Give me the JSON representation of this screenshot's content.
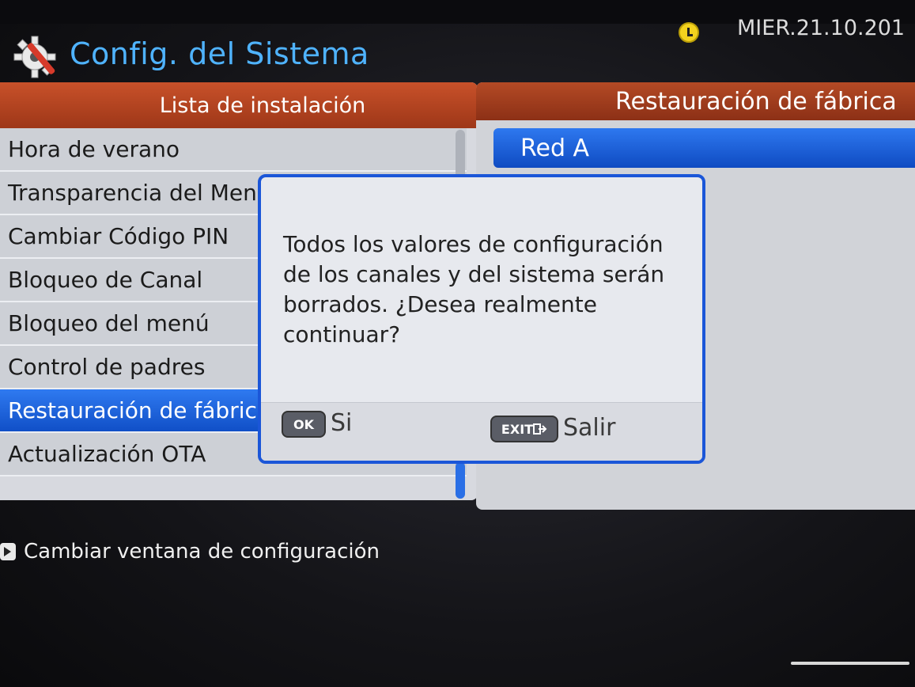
{
  "header": {
    "title": "Config. del Sistema",
    "date": "MIER.21.10.201",
    "icons": {
      "app": "settings-gear-icon",
      "clock": "clock-icon"
    }
  },
  "left_panel": {
    "title": "Lista de instalación",
    "items": [
      {
        "label": "Hora de verano"
      },
      {
        "label": "Transparencia del Menú"
      },
      {
        "label": "Cambiar Código PIN"
      },
      {
        "label": "Bloqueo de Canal"
      },
      {
        "label": "Bloqueo del menú"
      },
      {
        "label": "Control de padres"
      },
      {
        "label": "Restauración de fábrica",
        "selected": true
      },
      {
        "label": "Actualización OTA"
      }
    ]
  },
  "right_panel": {
    "title": "Restauración de fábrica",
    "option": "Red A"
  },
  "dialog": {
    "message": "Todos los valores de configuración de los canales y del sistema serán borrados. ¿Desea realmente continuar?",
    "ok_key": "OK",
    "ok_label": "Si",
    "exit_key": "EXIT",
    "exit_label": "Salir"
  },
  "footer": {
    "hint": "Cambiar ventana de configuración"
  },
  "colors": {
    "accent_blue": "#1e62df",
    "header_orange": "#b44a25",
    "title_blue": "#4fb3ff"
  }
}
